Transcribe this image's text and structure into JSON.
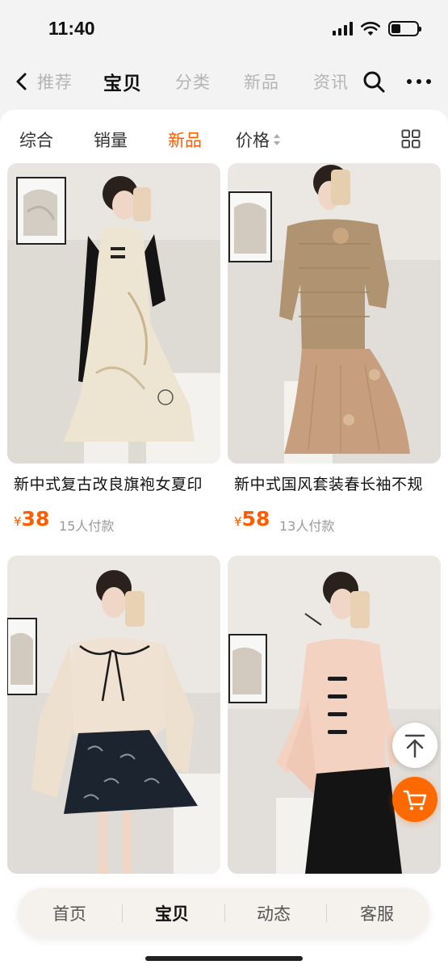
{
  "status_bar": {
    "time": "11:40"
  },
  "nav": {
    "tabs": [
      {
        "label": "推荐"
      },
      {
        "label": "宝贝"
      },
      {
        "label": "分类"
      },
      {
        "label": "新品"
      },
      {
        "label": "资讯"
      }
    ],
    "active_tab": "宝贝"
  },
  "sort": {
    "items": [
      {
        "label": "综合"
      },
      {
        "label": "销量"
      },
      {
        "label": "新品"
      },
      {
        "label": "价格"
      }
    ],
    "active": "新品",
    "accent_color": "#ff5b00"
  },
  "products": [
    {
      "title": "新中式复古改良旗袍女夏印",
      "currency": "¥",
      "price": "38",
      "sold": "15人付款"
    },
    {
      "title": "新中式国风套装春长袖不规",
      "currency": "¥",
      "price": "58",
      "sold": "13人付款"
    },
    {
      "title": "",
      "currency": "",
      "price": "",
      "sold": ""
    },
    {
      "title": "",
      "currency": "",
      "price": "",
      "sold": ""
    }
  ],
  "bottom_tabs": [
    {
      "label": "首页"
    },
    {
      "label": "宝贝"
    },
    {
      "label": "动态"
    },
    {
      "label": "客服"
    }
  ],
  "active_bottom_tab": "宝贝",
  "icons": [
    "back-icon",
    "search-icon",
    "more-icon",
    "price-sort-icon",
    "grid-view-icon",
    "scroll-top-icon",
    "cart-icon"
  ],
  "colors": {
    "accent": "#ff5b00",
    "cart_button": "#ff6a00"
  }
}
